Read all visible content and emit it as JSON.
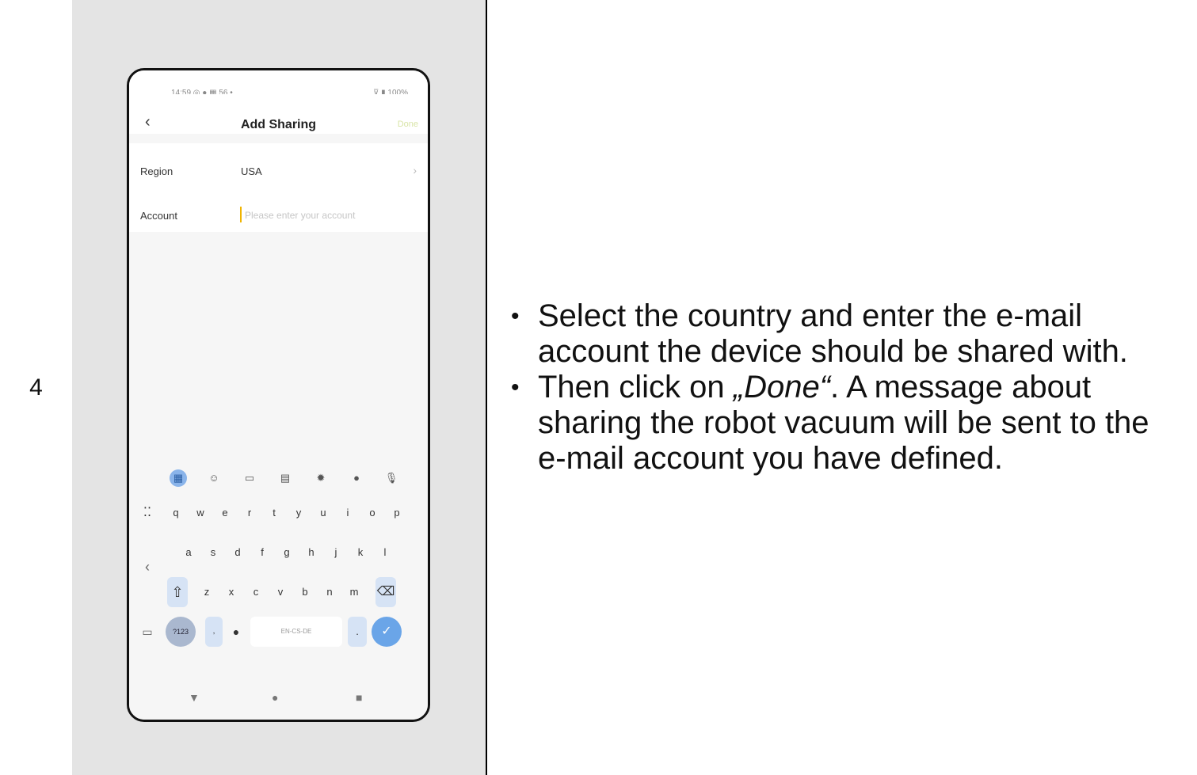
{
  "step": {
    "number": "4"
  },
  "phone": {
    "status_left": "14:59 ◎ ● ▦ 56 •",
    "status_right": "⊽ ▮ 100%",
    "title": "Add Sharing",
    "back_icon": "chevron-left",
    "done_label": "Done",
    "region_label": "Region",
    "region_value": "USA",
    "account_label": "Account",
    "account_placeholder": "Please enter your account",
    "keyboard": {
      "row1": [
        "q",
        "w",
        "e",
        "r",
        "t",
        "y",
        "u",
        "i",
        "o",
        "p"
      ],
      "row2": [
        "a",
        "s",
        "d",
        "f",
        "g",
        "h",
        "j",
        "k",
        "l"
      ],
      "row3": [
        "z",
        "x",
        "c",
        "v",
        "b",
        "n",
        "m"
      ],
      "num_key": "?123",
      "space_label": "EN-CS-DE",
      "period": "."
    }
  },
  "instructions": {
    "bullet1": "Select the country and enter the e-mail account the device should be shared with.",
    "bullet2_before": "Then click on ",
    "bullet2_em": "„Done“",
    "bullet2_after": ". A message about sharing the robot vacuum will be sent to the e-mail account you have defined."
  }
}
